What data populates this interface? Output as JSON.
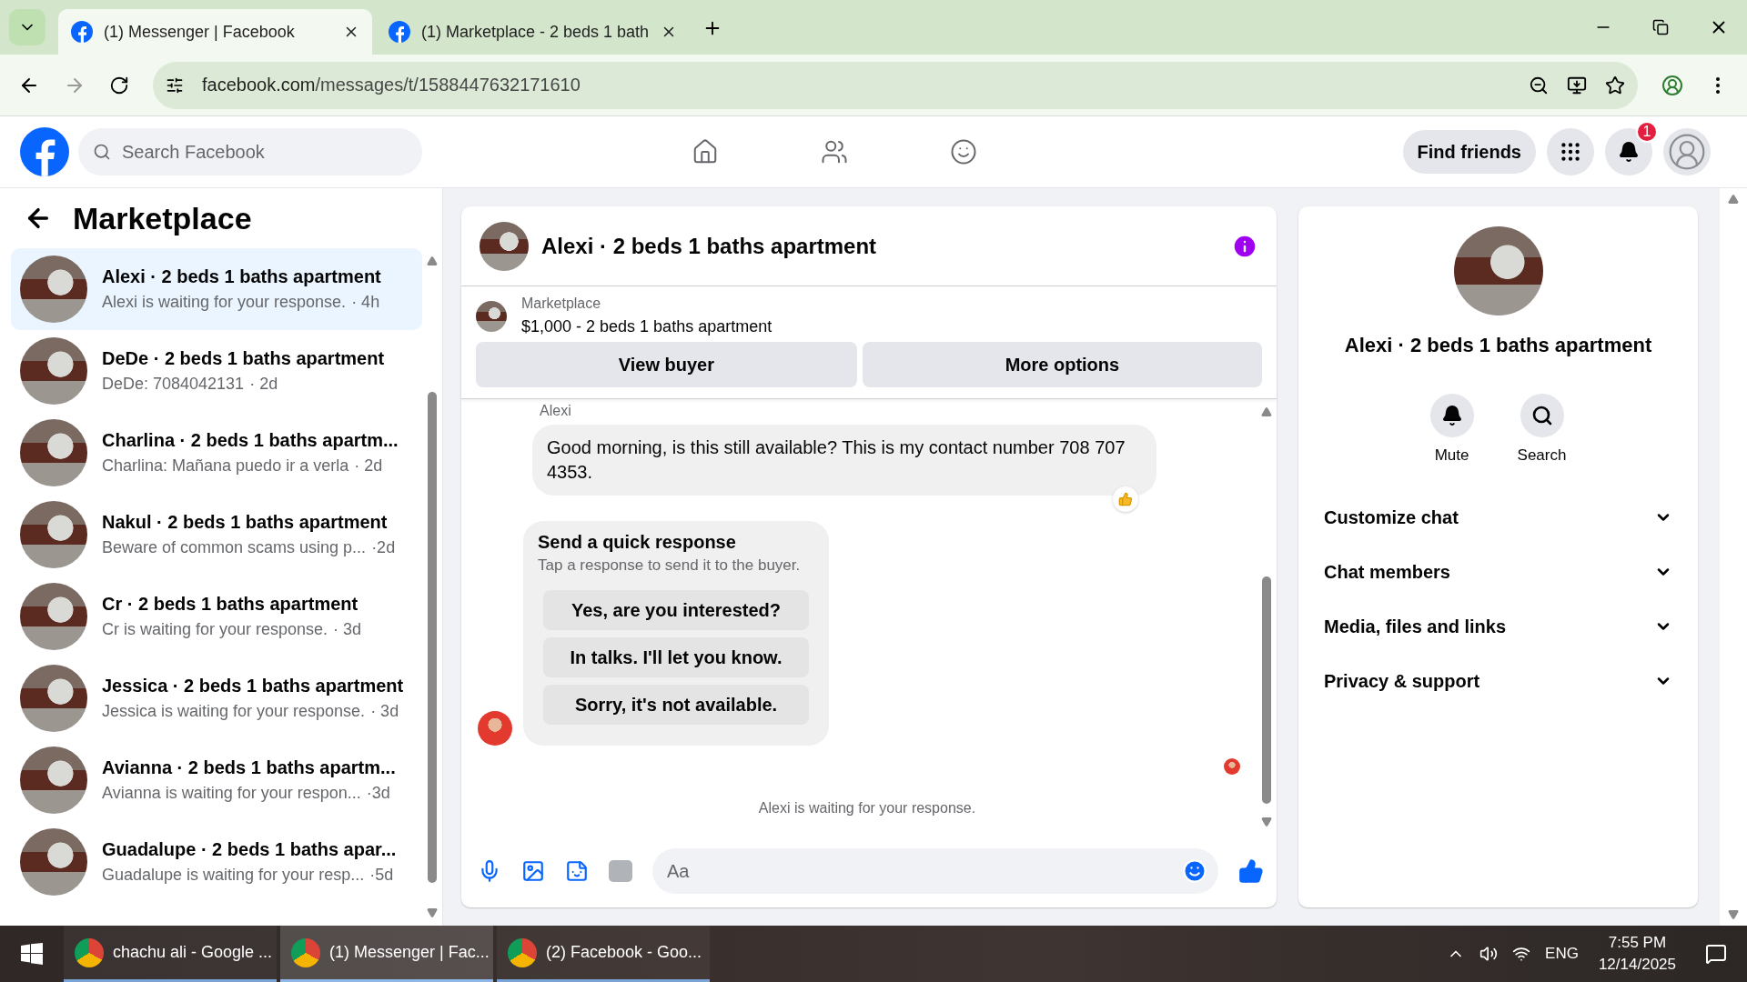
{
  "browser": {
    "tabs": [
      {
        "title": "(1) Messenger | Facebook",
        "selected": true
      },
      {
        "title": "(1) Marketplace - 2 beds 1 bath",
        "selected": false
      }
    ],
    "url_host": "facebook.com",
    "url_path": "/messages/t/1588447632171610"
  },
  "header": {
    "search_placeholder": "Search Facebook",
    "find_friends": "Find friends",
    "notification_count": "1"
  },
  "sidebar": {
    "title": "Marketplace",
    "conversations": [
      {
        "title": "Alexi · 2 beds 1 baths apartment",
        "preview": "Alexi is waiting for your response.",
        "time": "· 4h",
        "selected": true
      },
      {
        "title": "DeDe · 2 beds 1 baths apartment",
        "preview": "DeDe: 7084042131",
        "time": "· 2d",
        "selected": false
      },
      {
        "title": "Charlina · 2 beds 1 baths apartm...",
        "preview": "Charlina: Mañana puedo ir a verla",
        "time": "· 2d",
        "selected": false
      },
      {
        "title": "Nakul · 2 beds 1 baths apartment",
        "preview": "Beware of common scams using p...",
        "time": "·2d",
        "selected": false
      },
      {
        "title": "Cr · 2 beds 1 baths apartment",
        "preview": "Cr is waiting for your response.",
        "time": "· 3d",
        "selected": false
      },
      {
        "title": "Jessica · 2 beds 1 baths apartment",
        "preview": "Jessica is waiting for your response.",
        "time": "· 3d",
        "selected": false
      },
      {
        "title": "Avianna · 2 beds 1 baths apartm...",
        "preview": "Avianna is waiting for your respon...",
        "time": "·3d",
        "selected": false
      },
      {
        "title": "Guadalupe · 2 beds 1 baths apar...",
        "preview": "Guadalupe is waiting for your resp...",
        "time": "·5d",
        "selected": false
      }
    ]
  },
  "chat": {
    "title": "Alexi · 2 beds 1 baths apartment",
    "listing": {
      "label": "Marketplace",
      "text": "$1,000 - 2 beds 1 baths apartment"
    },
    "buttons": [
      "View buyer",
      "More options"
    ],
    "message": {
      "sender": "Alexi",
      "text": "Good morning, is this still available? This is my contact number 708 707 4353."
    },
    "quick_response": {
      "title": "Send a quick response",
      "subtitle": "Tap a response to send it to the buyer.",
      "options": [
        "Yes, are you interested?",
        "In talks. I'll let you know.",
        "Sorry, it's not available."
      ]
    },
    "status": "Alexi is waiting for your response.",
    "composer_placeholder": "Aa"
  },
  "details": {
    "title": "Alexi · 2 beds 1 baths apartment",
    "actions": [
      {
        "kind": "mute",
        "label": "Mute"
      },
      {
        "kind": "search",
        "label": "Search"
      }
    ],
    "sections": [
      {
        "label": "Customize chat",
        "expanded": false
      },
      {
        "label": "Chat members",
        "expanded": false
      },
      {
        "label": "Media, files and links",
        "expanded": false
      },
      {
        "label": "Privacy & support",
        "expanded": false
      }
    ]
  },
  "taskbar": {
    "apps": [
      {
        "label": "chachu ali - Google ...",
        "selected": false
      },
      {
        "label": "(1) Messenger | Fac...",
        "selected": true
      },
      {
        "label": "(2) Facebook - Goo...",
        "selected": false
      }
    ],
    "language": "ENG",
    "time": "7:55 PM",
    "date": "12/14/2025"
  }
}
